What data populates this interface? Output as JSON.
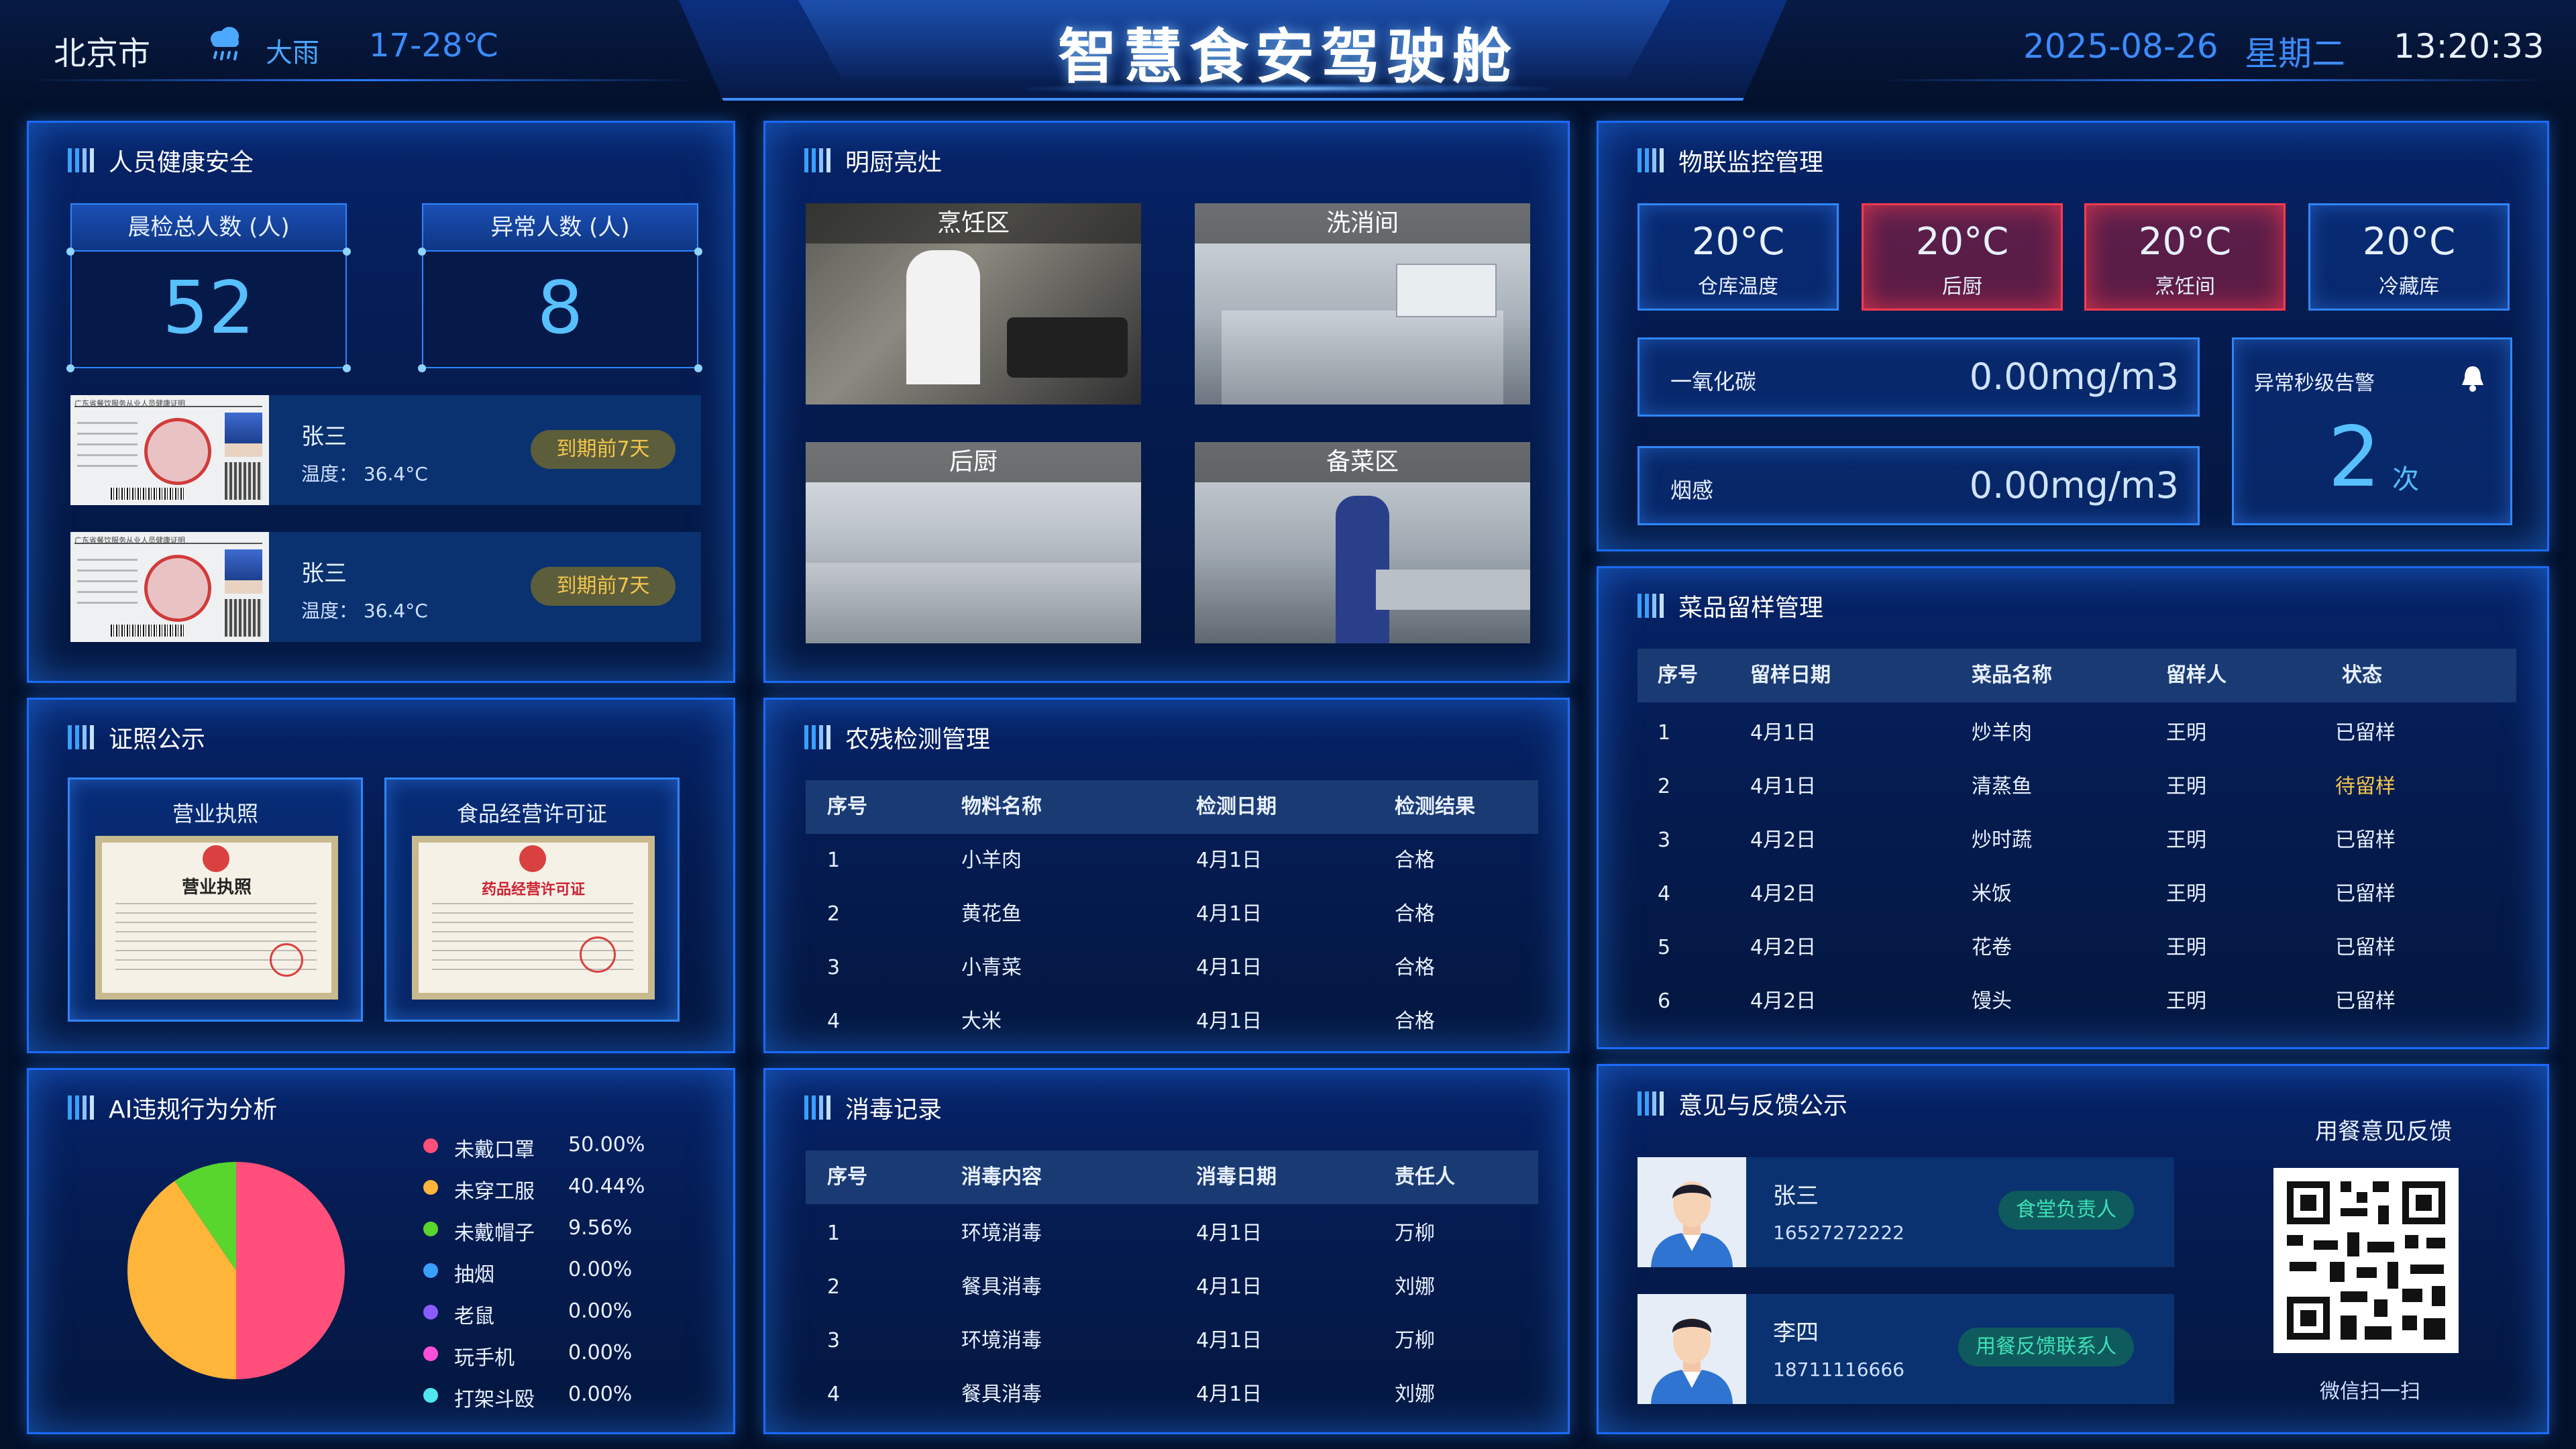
{
  "header": {
    "city": "北京市",
    "weather": "大雨",
    "temp_range": "17-28℃",
    "title": "智慧食安驾驶舱",
    "date": "2025-08-26",
    "weekday": "星期二",
    "time": "13:20:33"
  },
  "health": {
    "title": "人员健康安全",
    "total_label": "晨检总人数 (人)",
    "total_value": "52",
    "abnormal_label": "异常人数 (人)",
    "abnormal_value": "8",
    "cert_header": "广东省餐饮服务从业人员健康证明",
    "people": [
      {
        "name": "张三",
        "temp": "温度： 36.4°C",
        "badge": "到期前7天"
      },
      {
        "name": "张三",
        "temp": "温度： 36.4°C",
        "badge": "到期前7天"
      }
    ]
  },
  "kitchen": {
    "title": "明厨亮灶",
    "cameras": [
      {
        "label": "烹饪区"
      },
      {
        "label": "洗消间"
      },
      {
        "label": "后厨"
      },
      {
        "label": "备菜区"
      }
    ]
  },
  "licenses": {
    "title": "证照公示",
    "items": [
      {
        "label": "营业执照",
        "img_text": "营业执照"
      },
      {
        "label": "食品经营许可证",
        "img_text": "药品经营许可证"
      }
    ]
  },
  "ai": {
    "title": "AI违规行为分析",
    "legend": [
      {
        "name": "未戴口罩",
        "pct": "50.00%",
        "value": 50.0,
        "color": "#ff4f7a"
      },
      {
        "name": "未穿工服",
        "pct": "40.44%",
        "value": 40.44,
        "color": "#ffb43a"
      },
      {
        "name": "未戴帽子",
        "pct": "9.56%",
        "value": 9.56,
        "color": "#58d62e"
      },
      {
        "name": "抽烟",
        "pct": "0.00%",
        "value": 0,
        "color": "#3aa0ff"
      },
      {
        "name": "老鼠",
        "pct": "0.00%",
        "value": 0,
        "color": "#8a5cff"
      },
      {
        "name": "玩手机",
        "pct": "0.00%",
        "value": 0,
        "color": "#ff4fd8"
      },
      {
        "name": "打架斗殴",
        "pct": "0.00%",
        "value": 0,
        "color": "#4fe8f0"
      }
    ]
  },
  "pesticide": {
    "title": "农残检测管理",
    "headers": [
      "序号",
      "物料名称",
      "检测日期",
      "检测结果"
    ],
    "rows": [
      [
        "1",
        "小羊肉",
        "4月1日",
        "合格"
      ],
      [
        "2",
        "黄花鱼",
        "4月1日",
        "合格"
      ],
      [
        "3",
        "小青菜",
        "4月1日",
        "合格"
      ],
      [
        "4",
        "大米",
        "4月1日",
        "合格"
      ]
    ]
  },
  "disinfect": {
    "title": "消毒记录",
    "headers": [
      "序号",
      "消毒内容",
      "消毒日期",
      "责任人"
    ],
    "rows": [
      [
        "1",
        "环境消毒",
        "4月1日",
        "万柳"
      ],
      [
        "2",
        "餐具消毒",
        "4月1日",
        "刘娜"
      ],
      [
        "3",
        "环境消毒",
        "4月1日",
        "万柳"
      ],
      [
        "4",
        "餐具消毒",
        "4月1日",
        "刘娜"
      ]
    ]
  },
  "iot": {
    "title": "物联监控管理",
    "temps": [
      {
        "value": "20°C",
        "label": "仓库温度",
        "alert": false
      },
      {
        "value": "20°C",
        "label": "后厨",
        "alert": true
      },
      {
        "value": "20°C",
        "label": "烹饪间",
        "alert": true
      },
      {
        "value": "20°C",
        "label": "冷藏库",
        "alert": false
      }
    ],
    "co_label": "一氧化碳",
    "co_value": "0.00mg/m3",
    "smoke_label": "烟感",
    "smoke_value": "0.00mg/m3",
    "alarm_label": "异常秒级告警",
    "alarm_value": "2",
    "alarm_unit": "次"
  },
  "samples": {
    "title": "菜品留样管理",
    "headers": [
      "序号",
      "留样日期",
      "菜品名称",
      "留样人",
      "状态"
    ],
    "rows": [
      [
        "1",
        "4月1日",
        "炒羊肉",
        "王明",
        "已留样"
      ],
      [
        "2",
        "4月1日",
        "清蒸鱼",
        "王明",
        "待留样"
      ],
      [
        "3",
        "4月2日",
        "炒时蔬",
        "王明",
        "已留样"
      ],
      [
        "4",
        "4月2日",
        "米饭",
        "王明",
        "已留样"
      ],
      [
        "5",
        "4月2日",
        "花卷",
        "王明",
        "已留样"
      ],
      [
        "6",
        "4月2日",
        "馒头",
        "王明",
        "已留样"
      ]
    ],
    "pending_color": "#f4c64e"
  },
  "feedback": {
    "title": "意见与反馈公示",
    "people": [
      {
        "name": "张三",
        "phone": "16527272222",
        "role": "食堂负责人"
      },
      {
        "name": "李四",
        "phone": "18711116666",
        "role": "用餐反馈联系人"
      }
    ],
    "qr_title": "用餐意见反馈",
    "qr_caption": "微信扫一扫"
  }
}
